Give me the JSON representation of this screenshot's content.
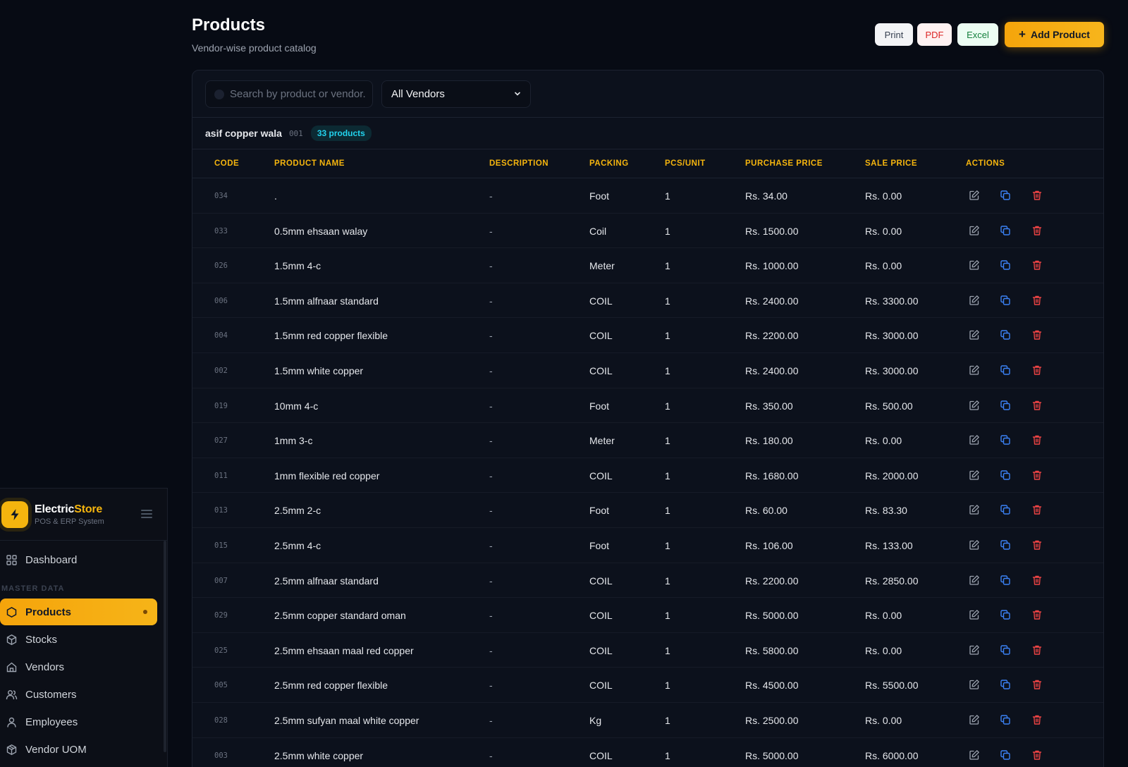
{
  "sidebar": {
    "brand_name_part1": "Electric",
    "brand_name_part2": "Store",
    "brand_sub": "POS & ERP System",
    "section_master": "MASTER DATA",
    "items": [
      {
        "label": "Dashboard",
        "icon": "grid-icon"
      },
      {
        "label": "Products",
        "icon": "hexagon-icon",
        "active": true
      },
      {
        "label": "Stocks",
        "icon": "box-icon"
      },
      {
        "label": "Vendors",
        "icon": "home-icon"
      },
      {
        "label": "Customers",
        "icon": "users-icon"
      },
      {
        "label": "Employees",
        "icon": "user-icon"
      },
      {
        "label": "Vendor UOM",
        "icon": "package-icon"
      }
    ]
  },
  "header": {
    "title": "Products",
    "subtitle": "Vendor-wise product catalog",
    "print_label": "Print",
    "pdf_label": "PDF",
    "excel_label": "Excel",
    "add_label": "Add Product"
  },
  "filters": {
    "search_placeholder": "Search by product or vendor...",
    "vendor_select": "All Vendors"
  },
  "vendor": {
    "name": "asif copper wala",
    "code": "001",
    "count": "33 products"
  },
  "columns": [
    "CODE",
    "PRODUCT NAME",
    "DESCRIPTION",
    "PACKING",
    "PCS/UNIT",
    "PURCHASE PRICE",
    "SALE PRICE",
    "ACTIONS"
  ],
  "rows": [
    {
      "code": "034",
      "name": ".",
      "desc": "-",
      "packing": "Foot",
      "pcs": "1",
      "purchase": "Rs. 34.00",
      "sale": "Rs. 0.00"
    },
    {
      "code": "033",
      "name": "0.5mm ehsaan walay",
      "desc": "-",
      "packing": "Coil",
      "pcs": "1",
      "purchase": "Rs. 1500.00",
      "sale": "Rs. 0.00"
    },
    {
      "code": "026",
      "name": "1.5mm 4-c",
      "desc": "-",
      "packing": "Meter",
      "pcs": "1",
      "purchase": "Rs. 1000.00",
      "sale": "Rs. 0.00"
    },
    {
      "code": "006",
      "name": "1.5mm alfnaar standard",
      "desc": "-",
      "packing": "COIL",
      "pcs": "1",
      "purchase": "Rs. 2400.00",
      "sale": "Rs. 3300.00"
    },
    {
      "code": "004",
      "name": "1.5mm red copper flexible",
      "desc": "-",
      "packing": "COIL",
      "pcs": "1",
      "purchase": "Rs. 2200.00",
      "sale": "Rs. 3000.00"
    },
    {
      "code": "002",
      "name": "1.5mm white copper",
      "desc": "-",
      "packing": "COIL",
      "pcs": "1",
      "purchase": "Rs. 2400.00",
      "sale": "Rs. 3000.00"
    },
    {
      "code": "019",
      "name": "10mm 4-c",
      "desc": "-",
      "packing": "Foot",
      "pcs": "1",
      "purchase": "Rs. 350.00",
      "sale": "Rs. 500.00"
    },
    {
      "code": "027",
      "name": "1mm 3-c",
      "desc": "-",
      "packing": "Meter",
      "pcs": "1",
      "purchase": "Rs. 180.00",
      "sale": "Rs. 0.00"
    },
    {
      "code": "011",
      "name": "1mm flexible red copper",
      "desc": "-",
      "packing": "COIL",
      "pcs": "1",
      "purchase": "Rs. 1680.00",
      "sale": "Rs. 2000.00"
    },
    {
      "code": "013",
      "name": "2.5mm 2-c",
      "desc": "-",
      "packing": "Foot",
      "pcs": "1",
      "purchase": "Rs. 60.00",
      "sale": "Rs. 83.30"
    },
    {
      "code": "015",
      "name": "2.5mm 4-c",
      "desc": "-",
      "packing": "Foot",
      "pcs": "1",
      "purchase": "Rs. 106.00",
      "sale": "Rs. 133.00"
    },
    {
      "code": "007",
      "name": "2.5mm alfnaar standard",
      "desc": "-",
      "packing": "COIL",
      "pcs": "1",
      "purchase": "Rs. 2200.00",
      "sale": "Rs. 2850.00"
    },
    {
      "code": "029",
      "name": "2.5mm copper standard oman",
      "desc": "-",
      "packing": "COIL",
      "pcs": "1",
      "purchase": "Rs. 5000.00",
      "sale": "Rs. 0.00"
    },
    {
      "code": "025",
      "name": "2.5mm ehsaan maal red copper",
      "desc": "-",
      "packing": "COIL",
      "pcs": "1",
      "purchase": "Rs. 5800.00",
      "sale": "Rs. 0.00"
    },
    {
      "code": "005",
      "name": "2.5mm red copper flexible",
      "desc": "-",
      "packing": "COIL",
      "pcs": "1",
      "purchase": "Rs. 4500.00",
      "sale": "Rs. 5500.00"
    },
    {
      "code": "028",
      "name": "2.5mm sufyan maal white copper",
      "desc": "-",
      "packing": "Kg",
      "pcs": "1",
      "purchase": "Rs. 2500.00",
      "sale": "Rs. 0.00"
    },
    {
      "code": "003",
      "name": "2.5mm white copper",
      "desc": "-",
      "packing": "COIL",
      "pcs": "1",
      "purchase": "Rs. 5000.00",
      "sale": "Rs. 6000.00"
    }
  ],
  "colors": {
    "accent": "#f5b50e",
    "badge": "#22d3ee",
    "delete": "#ef4444",
    "copy": "#3b82f6"
  }
}
